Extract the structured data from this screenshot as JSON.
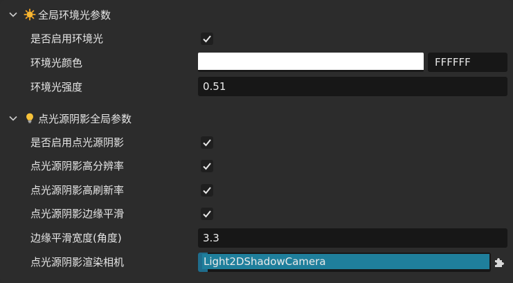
{
  "sections": [
    {
      "title": "全局环境光参数",
      "icon": "sun-icon",
      "rows": [
        {
          "label": "是否启用环境光",
          "type": "checkbox",
          "checked": true
        },
        {
          "label": "环境光颜色",
          "type": "color",
          "hex": "FFFFFF",
          "swatch": "#ffffff"
        },
        {
          "label": "环境光强度",
          "type": "number",
          "value": "0.51"
        }
      ]
    },
    {
      "title": "点光源阴影全局参数",
      "icon": "lightbulb-icon",
      "rows": [
        {
          "label": "是否启用点光源阴影",
          "type": "checkbox",
          "checked": true
        },
        {
          "label": "点光源阴影高分辨率",
          "type": "checkbox",
          "checked": true
        },
        {
          "label": "点光源阴影高刷新率",
          "type": "checkbox",
          "checked": true
        },
        {
          "label": "点光源阴影边缘平滑",
          "type": "checkbox",
          "checked": true
        },
        {
          "label": "边缘平滑宽度(角度)",
          "type": "number",
          "value": "3.3"
        },
        {
          "label": "点光源阴影渲染相机",
          "type": "object",
          "value": "Light2DShadowCamera"
        }
      ]
    }
  ],
  "colors": {
    "panel_bg": "#2c2c2c",
    "field_bg": "#171717",
    "object_accent": "#1f7f9c"
  }
}
